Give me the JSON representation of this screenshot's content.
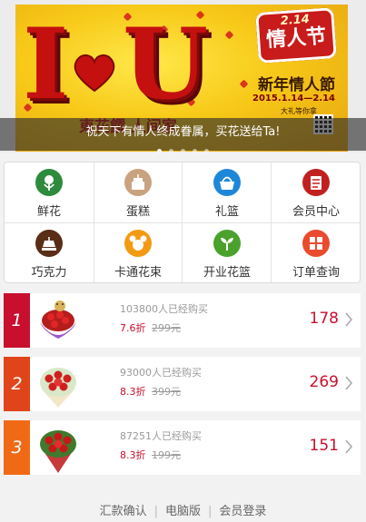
{
  "banner": {
    "caption": "祝天下有情人终成眷属，买花送给Ta!",
    "dot_count": 5,
    "active_dot": 0,
    "art": {
      "letters": [
        "I",
        "U"
      ],
      "badge_top": "2.14",
      "badge_main": "情人节",
      "headline": "新年情人節",
      "dates": "2015.1.14—2.14",
      "subline": "大礼等你拿",
      "footer_red": "東花饌  人间家"
    }
  },
  "menu": {
    "items": [
      {
        "label": "鲜花",
        "icon": "flower-icon",
        "color": "#2e8b3d"
      },
      {
        "label": "蛋糕",
        "icon": "cake-icon",
        "color": "#c9a37f"
      },
      {
        "label": "礼篮",
        "icon": "basket-icon",
        "color": "#1f87d8"
      },
      {
        "label": "会员中心",
        "icon": "member-card-icon",
        "color": "#c0211f"
      },
      {
        "label": "巧克力",
        "icon": "chocolate-icon",
        "color": "#5a2d17"
      },
      {
        "label": "卡通花束",
        "icon": "cartoon-bouquet-icon",
        "color": "#f39a13"
      },
      {
        "label": "开业花篮",
        "icon": "plant-icon",
        "color": "#4aa22c"
      },
      {
        "label": "订单查询",
        "icon": "order-search-icon",
        "color": "#ea4b2f"
      }
    ]
  },
  "products": [
    {
      "rank": "1",
      "buyers": "103800人已经购买",
      "discount": "7.6折",
      "original_price": "299元",
      "price": "178",
      "rank_color": "#c8102e"
    },
    {
      "rank": "2",
      "buyers": "93000人已经购买",
      "discount": "8.3折",
      "original_price": "399元",
      "price": "269",
      "rank_color": "#e0451a"
    },
    {
      "rank": "3",
      "buyers": "87251人已经购买",
      "discount": "8.3折",
      "original_price": "199元",
      "price": "151",
      "rank_color": "#f06a16"
    }
  ],
  "footer": {
    "links": [
      "汇款确认",
      "电脑版",
      "会员登录"
    ]
  }
}
